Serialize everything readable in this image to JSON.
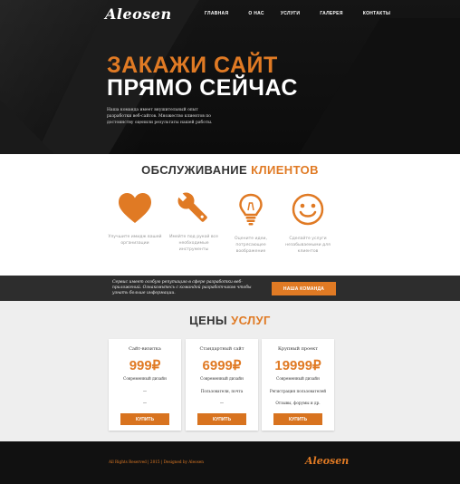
{
  "header": {
    "logo": "Aleosen",
    "nav": [
      "ГЛАВНАЯ",
      "О НАС",
      "УСЛУГИ",
      "ГАЛЕРЕЯ",
      "КОНТАКТЫ"
    ]
  },
  "hero": {
    "title_line1": "ЗАКАЖИ САЙТ",
    "title_line2": "ПРЯМО СЕЙЧАС",
    "text": "Наша команда имеет внушительный опыт разработки веб-сайтов. Множество клиентов по достоинству оценили результаты нашей работы."
  },
  "services": {
    "title_dark": "ОБСЛУЖИВАНИЕ",
    "title_accent": "КЛИЕНТОВ",
    "items": [
      {
        "icon": "heart-icon",
        "text": "Улучшите имидж вашей организации"
      },
      {
        "icon": "wrench-icon",
        "text": "Имейте под рукой все необходимые инструменты"
      },
      {
        "icon": "lightbulb-icon",
        "text": "Оцените идеи, потрясающее воображение"
      },
      {
        "icon": "smiley-icon",
        "text": "Сделайте услуги незабываемыми для клиентов"
      }
    ]
  },
  "banner": {
    "text": "Сервис имеет особую репутацию в сфере разработки веб-приложений. Ознакомьтесь с командой разработчиков чтобы узнать больше информации.",
    "button": "НАША КОМАНДА"
  },
  "prices": {
    "title_dark": "ЦЕНЫ",
    "title_accent": "УСЛУГ",
    "cards": [
      {
        "name": "Сайт-визитка",
        "price": "999₽",
        "f1": "Современный дизайн",
        "f2": "—",
        "f3": "—",
        "button": "КУПИТЬ"
      },
      {
        "name": "Стандартный сайт",
        "price": "6999₽",
        "f1": "Современный дизайн",
        "f2": "Пользователи, почта",
        "f3": "—",
        "button": "КУПИТЬ"
      },
      {
        "name": "Крупный проект",
        "price": "19999₽",
        "f1": "Современный дизайн",
        "f2": "Регистрация пользователей",
        "f3": "Отзывы, форумы и др.",
        "button": "КУПИТЬ"
      }
    ]
  },
  "footer": {
    "copyright": "All Rights Reserved | 2015 | Designed by Aleosen",
    "logo": "Aleosen"
  },
  "colors": {
    "accent": "#e07a24",
    "dark": "#111111",
    "banner": "#2d2d2d",
    "light": "#eeeeee"
  }
}
